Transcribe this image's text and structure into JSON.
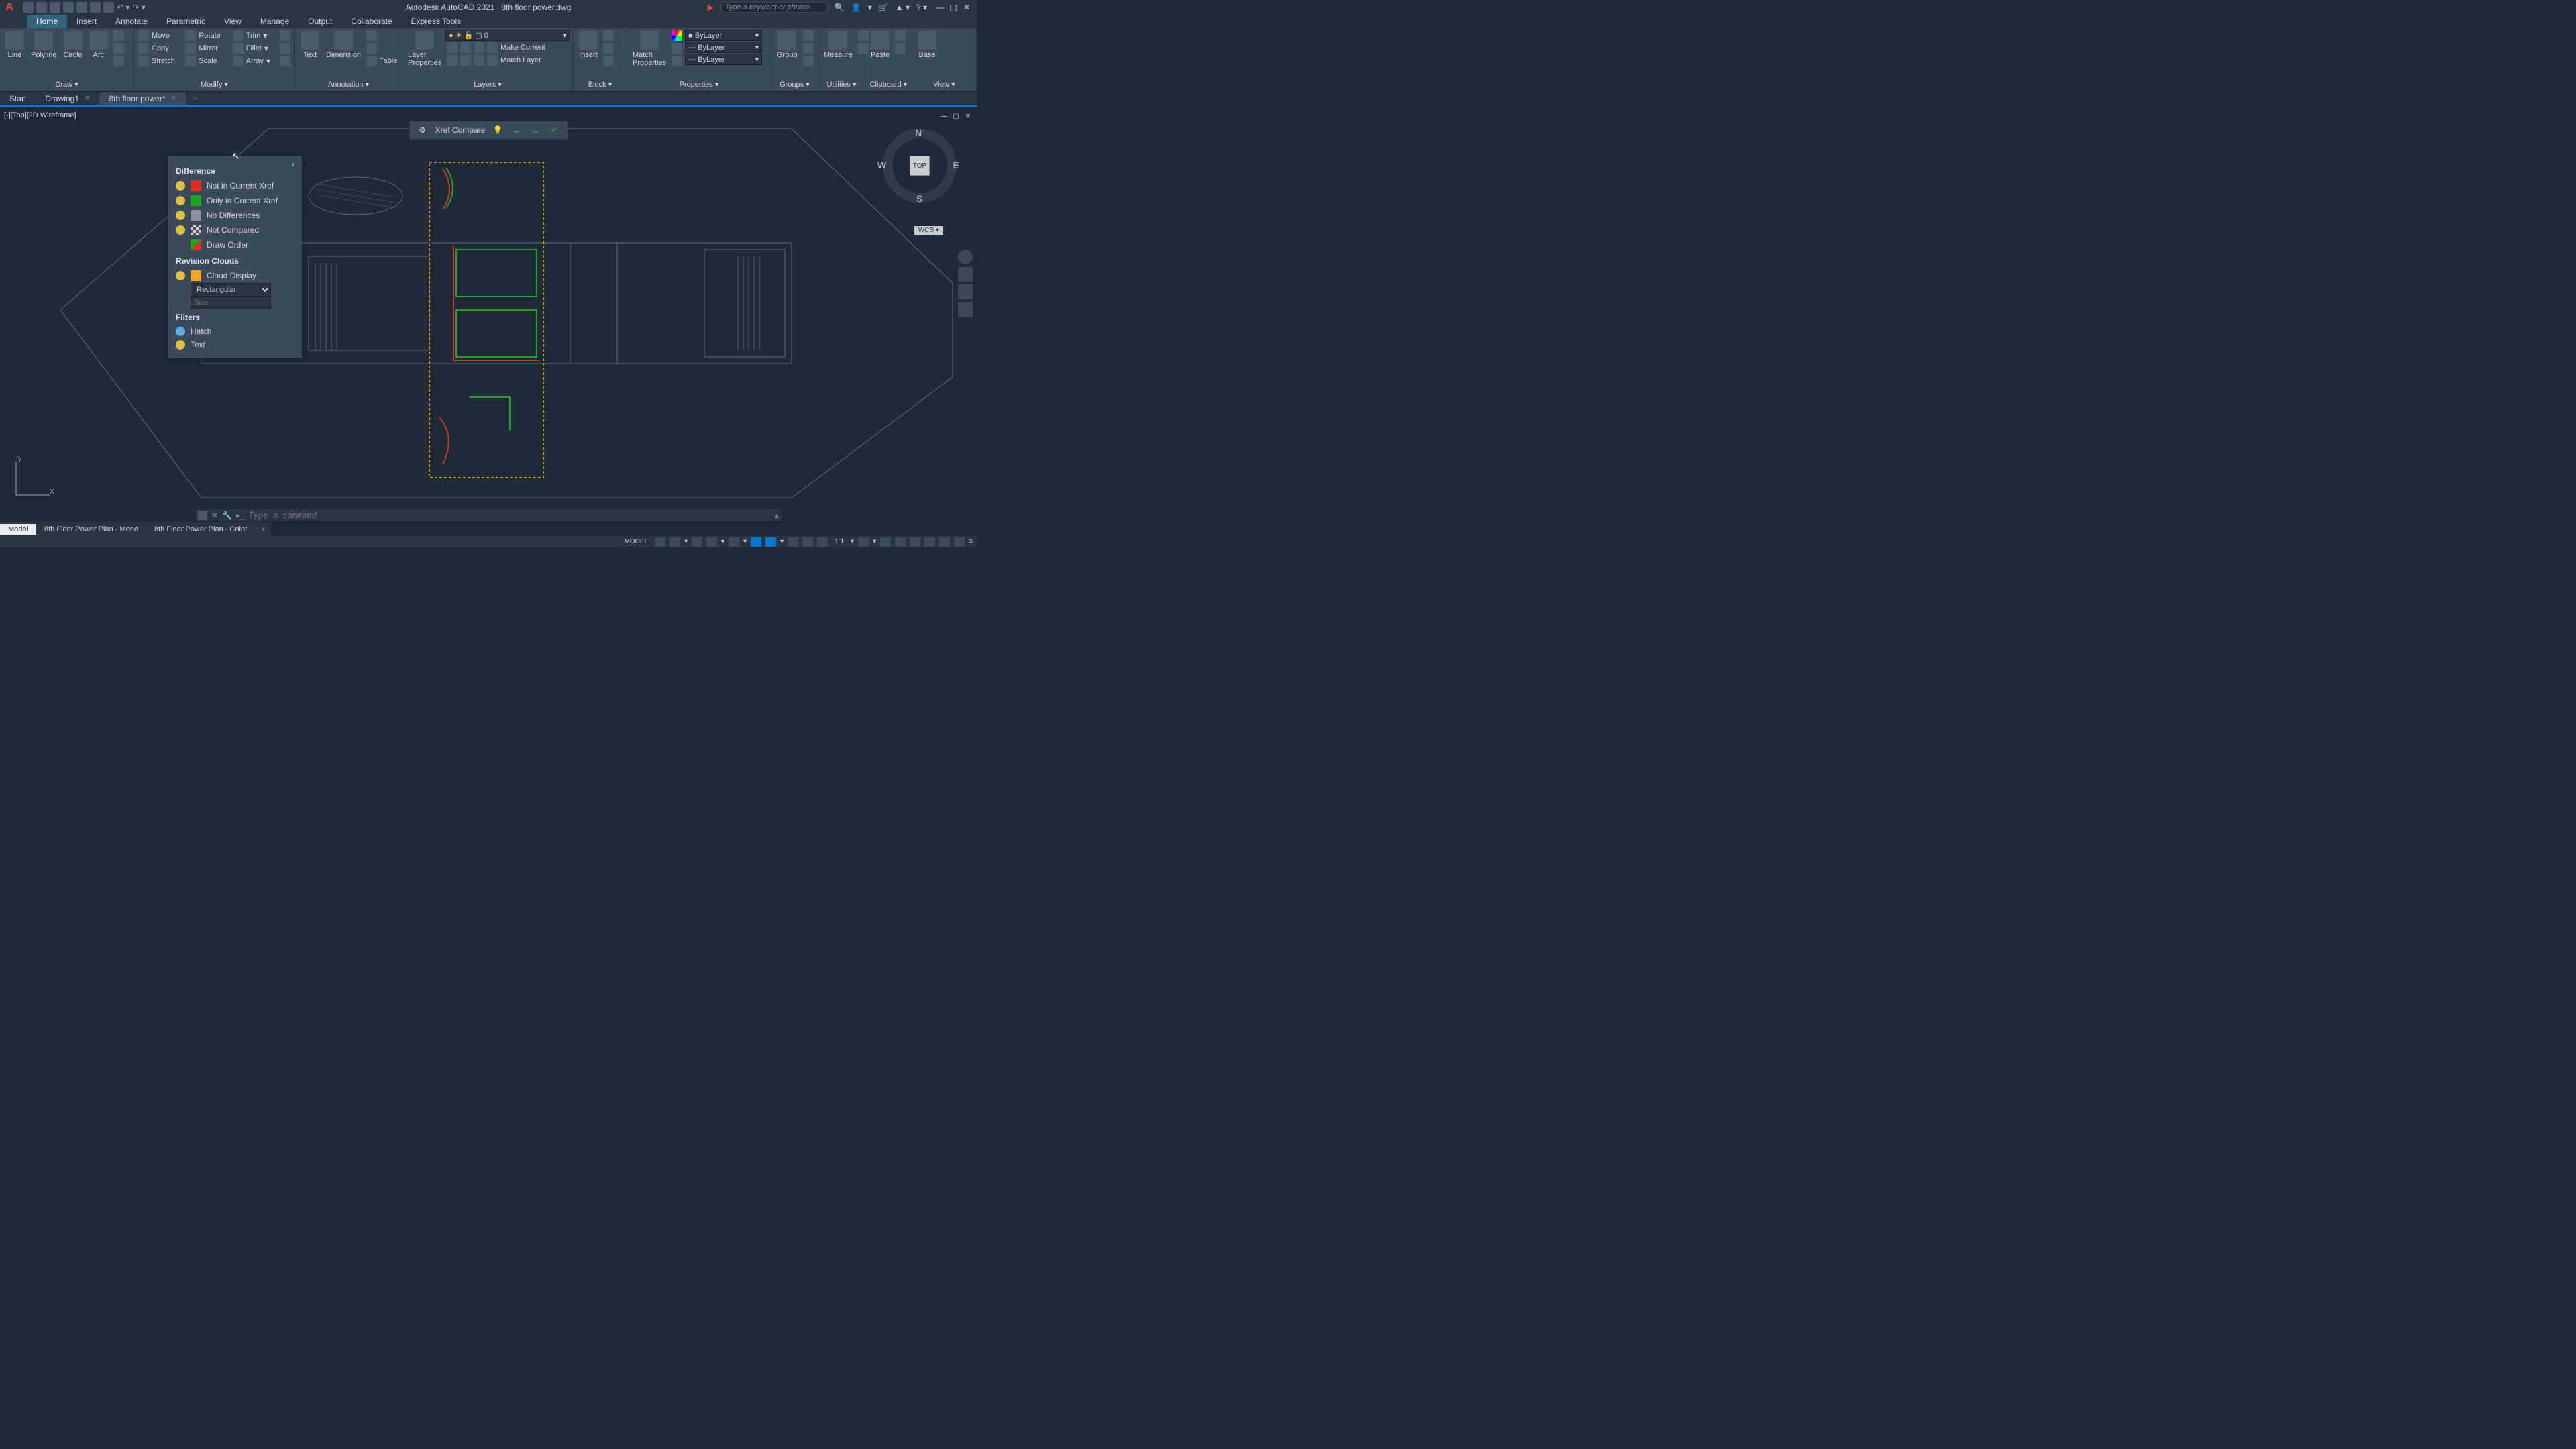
{
  "app": {
    "name": "Autodesk AutoCAD 2021",
    "document": "8th floor power.dwg",
    "search_placeholder": "Type a keyword or phrase"
  },
  "ribbon": {
    "tabs": [
      "Home",
      "Insert",
      "Annotate",
      "Parametric",
      "View",
      "Manage",
      "Output",
      "Collaborate",
      "Express Tools"
    ],
    "active_tab": "Home",
    "panels": {
      "draw": {
        "label": "Draw",
        "items": [
          "Line",
          "Polyline",
          "Circle",
          "Arc"
        ]
      },
      "modify": {
        "label": "Modify",
        "items": [
          "Move",
          "Rotate",
          "Trim",
          "Copy",
          "Mirror",
          "Fillet",
          "Stretch",
          "Scale",
          "Array"
        ]
      },
      "annotation": {
        "label": "Annotation",
        "items": [
          "Text",
          "Dimension",
          "Table"
        ]
      },
      "layers": {
        "label": "Layers",
        "big": "Layer\nProperties",
        "items": [
          "Make Current",
          "Match Layer"
        ],
        "current": "0"
      },
      "block": {
        "label": "Block",
        "big": "Insert"
      },
      "properties": {
        "label": "Properties",
        "big": "Match\nProperties",
        "vals": [
          "ByLayer",
          "ByLayer",
          "ByLayer"
        ]
      },
      "groups": {
        "label": "Groups",
        "big": "Group"
      },
      "utilities": {
        "label": "Utilities",
        "big": "Measure"
      },
      "clipboard": {
        "label": "Clipboard",
        "big": "Paste"
      },
      "view": {
        "label": "View",
        "big": "Base"
      }
    }
  },
  "file_tabs": {
    "items": [
      {
        "label": "Start",
        "closable": false
      },
      {
        "label": "Drawing1",
        "closable": true
      },
      {
        "label": "8th floor power*",
        "closable": true,
        "active": true
      }
    ]
  },
  "viewport": {
    "label": "[-][Top][2D Wireframe]"
  },
  "xref_compare": {
    "title": "Xref Compare"
  },
  "diff_panel": {
    "headings": {
      "difference": "Difference",
      "clouds": "Revision Clouds",
      "filters": "Filters"
    },
    "rows": {
      "not_in_current": "Not in Current Xref",
      "only_in_current": "Only in Current Xref",
      "no_diff": "No Differences",
      "not_compared": "Not Compared",
      "draw_order": "Draw Order",
      "cloud_display": "Cloud Display",
      "shape": "Rectangular",
      "size_placeholder": "Size",
      "hatch": "Hatch",
      "text": "Text"
    },
    "colors": {
      "not_in_current": "#d93025",
      "only_in_current": "#1fa81f",
      "no_diff": "#8a9099",
      "not_compared_pattern": true,
      "draw_order": "#1fa81f",
      "cloud_display": "#f5a623"
    }
  },
  "viewcube": {
    "face": "TOP",
    "n": "N",
    "s": "S",
    "e": "E",
    "w": "W",
    "wcs": "WCS"
  },
  "command": {
    "placeholder": "Type a command"
  },
  "layout_tabs": {
    "items": [
      {
        "label": "Model",
        "active": true
      },
      {
        "label": "8th Floor Power Plan - Mono"
      },
      {
        "label": "8th Floor Power Plan - Color"
      }
    ]
  },
  "statusbar": {
    "model": "MODEL",
    "scale": "1:1"
  }
}
